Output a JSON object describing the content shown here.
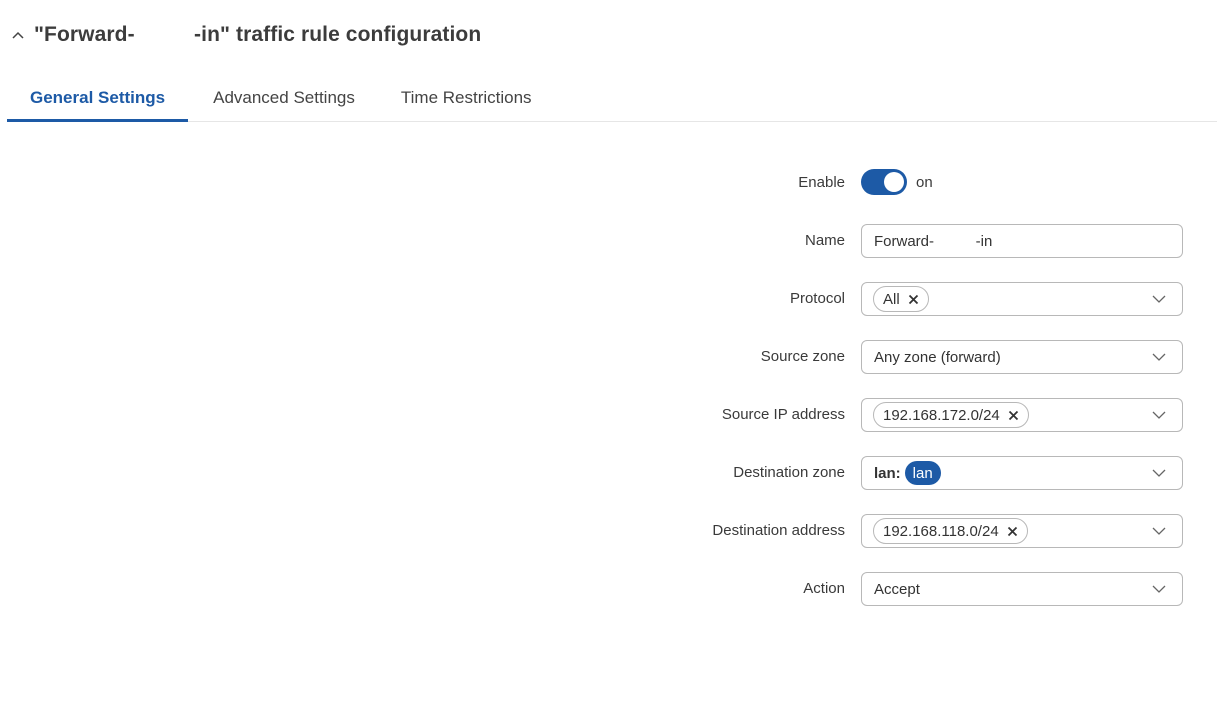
{
  "header": {
    "title": "\"Forward-          -in\" traffic rule configuration"
  },
  "tabs": [
    {
      "label": "General Settings",
      "active": true
    },
    {
      "label": "Advanced Settings",
      "active": false
    },
    {
      "label": "Time Restrictions",
      "active": false
    }
  ],
  "form": {
    "enable": {
      "label": "Enable",
      "state": "on"
    },
    "name": {
      "label": "Name",
      "value": "Forward-          -in"
    },
    "protocol": {
      "label": "Protocol",
      "chip": "All"
    },
    "source_zone": {
      "label": "Source zone",
      "value": "Any zone (forward)"
    },
    "source_ip": {
      "label": "Source IP address",
      "chip": "192.168.172.0/24"
    },
    "destination_zone": {
      "label": "Destination zone",
      "prefix": "lan:",
      "badge": "lan"
    },
    "destination_address": {
      "label": "Destination address",
      "chip": "192.168.118.0/24"
    },
    "action": {
      "label": "Action",
      "value": "Accept"
    }
  },
  "colors": {
    "accent": "#1d5aa6",
    "border": "#b8b8b8",
    "text": "#333333"
  }
}
